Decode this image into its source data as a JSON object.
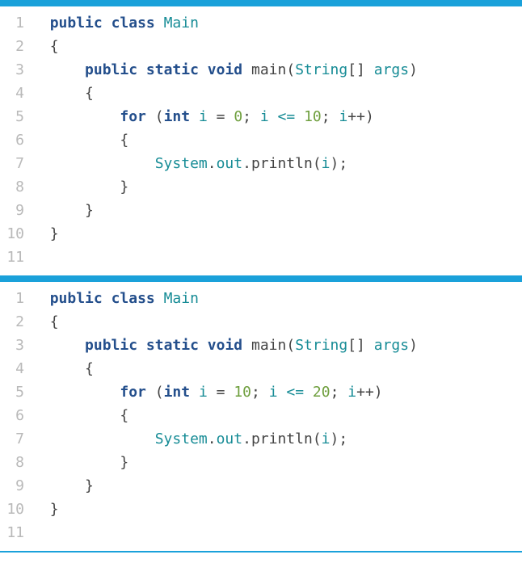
{
  "blocks": [
    {
      "lines": [
        {
          "n": "1",
          "tokens": [
            [
              "sp",
              "  "
            ],
            [
              "kw",
              "public"
            ],
            [
              "sp",
              " "
            ],
            [
              "kw",
              "class"
            ],
            [
              "sp",
              " "
            ],
            [
              "ty",
              "Main"
            ]
          ]
        },
        {
          "n": "2",
          "tokens": [
            [
              "sp",
              "  "
            ],
            [
              "pl",
              "{"
            ]
          ]
        },
        {
          "n": "3",
          "tokens": [
            [
              "sp",
              "      "
            ],
            [
              "kw",
              "public"
            ],
            [
              "sp",
              " "
            ],
            [
              "kw",
              "static"
            ],
            [
              "sp",
              " "
            ],
            [
              "kw",
              "void"
            ],
            [
              "sp",
              " "
            ],
            [
              "fn",
              "main"
            ],
            [
              "pl",
              "("
            ],
            [
              "ty",
              "String"
            ],
            [
              "pl",
              "[] "
            ],
            [
              "ty",
              "args"
            ],
            [
              "pl",
              ")"
            ]
          ]
        },
        {
          "n": "4",
          "tokens": [
            [
              "sp",
              "      "
            ],
            [
              "pl",
              "{"
            ]
          ]
        },
        {
          "n": "5",
          "tokens": [
            [
              "sp",
              "          "
            ],
            [
              "kw",
              "for"
            ],
            [
              "sp",
              " "
            ],
            [
              "pl",
              "("
            ],
            [
              "kw",
              "int"
            ],
            [
              "sp",
              " "
            ],
            [
              "ty",
              "i"
            ],
            [
              "sp",
              " "
            ],
            [
              "pl",
              "="
            ],
            [
              "sp",
              " "
            ],
            [
              "nu",
              "0"
            ],
            [
              "pl",
              ";"
            ],
            [
              "sp",
              " "
            ],
            [
              "ty",
              "i"
            ],
            [
              "sp",
              " "
            ],
            [
              "op",
              "<="
            ],
            [
              "sp",
              " "
            ],
            [
              "nu",
              "10"
            ],
            [
              "pl",
              ";"
            ],
            [
              "sp",
              " "
            ],
            [
              "ty",
              "i"
            ],
            [
              "pl",
              "++)"
            ]
          ]
        },
        {
          "n": "6",
          "tokens": [
            [
              "sp",
              "          "
            ],
            [
              "pl",
              "{"
            ]
          ]
        },
        {
          "n": "7",
          "tokens": [
            [
              "sp",
              "              "
            ],
            [
              "ty",
              "System"
            ],
            [
              "pl",
              "."
            ],
            [
              "ty",
              "out"
            ],
            [
              "pl",
              "."
            ],
            [
              "fn",
              "println"
            ],
            [
              "pl",
              "("
            ],
            [
              "ty",
              "i"
            ],
            [
              "pl",
              ");"
            ]
          ]
        },
        {
          "n": "8",
          "tokens": [
            [
              "sp",
              "          "
            ],
            [
              "pl",
              "}"
            ]
          ]
        },
        {
          "n": "9",
          "tokens": [
            [
              "sp",
              "      "
            ],
            [
              "pl",
              "}"
            ]
          ]
        },
        {
          "n": "10",
          "tokens": [
            [
              "sp",
              "  "
            ],
            [
              "pl",
              "}"
            ]
          ]
        },
        {
          "n": "11",
          "tokens": []
        }
      ]
    },
    {
      "lines": [
        {
          "n": "1",
          "tokens": [
            [
              "sp",
              "  "
            ],
            [
              "kw",
              "public"
            ],
            [
              "sp",
              " "
            ],
            [
              "kw",
              "class"
            ],
            [
              "sp",
              " "
            ],
            [
              "ty",
              "Main"
            ]
          ]
        },
        {
          "n": "2",
          "tokens": [
            [
              "sp",
              "  "
            ],
            [
              "pl",
              "{"
            ]
          ]
        },
        {
          "n": "3",
          "tokens": [
            [
              "sp",
              "      "
            ],
            [
              "kw",
              "public"
            ],
            [
              "sp",
              " "
            ],
            [
              "kw",
              "static"
            ],
            [
              "sp",
              " "
            ],
            [
              "kw",
              "void"
            ],
            [
              "sp",
              " "
            ],
            [
              "fn",
              "main"
            ],
            [
              "pl",
              "("
            ],
            [
              "ty",
              "String"
            ],
            [
              "pl",
              "[] "
            ],
            [
              "ty",
              "args"
            ],
            [
              "pl",
              ")"
            ]
          ]
        },
        {
          "n": "4",
          "tokens": [
            [
              "sp",
              "      "
            ],
            [
              "pl",
              "{"
            ]
          ]
        },
        {
          "n": "5",
          "tokens": [
            [
              "sp",
              "          "
            ],
            [
              "kw",
              "for"
            ],
            [
              "sp",
              " "
            ],
            [
              "pl",
              "("
            ],
            [
              "kw",
              "int"
            ],
            [
              "sp",
              " "
            ],
            [
              "ty",
              "i"
            ],
            [
              "sp",
              " "
            ],
            [
              "pl",
              "="
            ],
            [
              "sp",
              " "
            ],
            [
              "nu",
              "10"
            ],
            [
              "pl",
              ";"
            ],
            [
              "sp",
              " "
            ],
            [
              "ty",
              "i"
            ],
            [
              "sp",
              " "
            ],
            [
              "op",
              "<="
            ],
            [
              "sp",
              " "
            ],
            [
              "nu",
              "20"
            ],
            [
              "pl",
              ";"
            ],
            [
              "sp",
              " "
            ],
            [
              "ty",
              "i"
            ],
            [
              "pl",
              "++)"
            ]
          ]
        },
        {
          "n": "6",
          "tokens": [
            [
              "sp",
              "          "
            ],
            [
              "pl",
              "{"
            ]
          ]
        },
        {
          "n": "7",
          "tokens": [
            [
              "sp",
              "              "
            ],
            [
              "ty",
              "System"
            ],
            [
              "pl",
              "."
            ],
            [
              "ty",
              "out"
            ],
            [
              "pl",
              "."
            ],
            [
              "fn",
              "println"
            ],
            [
              "pl",
              "("
            ],
            [
              "ty",
              "i"
            ],
            [
              "pl",
              ");"
            ]
          ]
        },
        {
          "n": "8",
          "tokens": [
            [
              "sp",
              "          "
            ],
            [
              "pl",
              "}"
            ]
          ]
        },
        {
          "n": "9",
          "tokens": [
            [
              "sp",
              "      "
            ],
            [
              "pl",
              "}"
            ]
          ]
        },
        {
          "n": "10",
          "tokens": [
            [
              "sp",
              "  "
            ],
            [
              "pl",
              "}"
            ]
          ]
        },
        {
          "n": "11",
          "tokens": []
        }
      ]
    }
  ]
}
